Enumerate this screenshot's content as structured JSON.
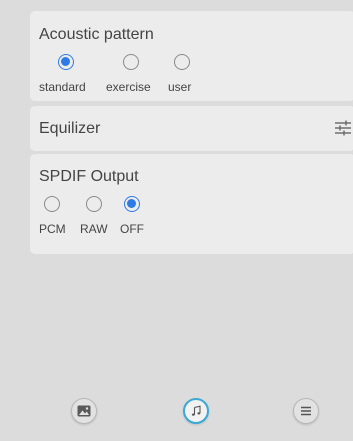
{
  "acoustic": {
    "title": "Acoustic pattern",
    "options": [
      {
        "label": "standard",
        "checked": true
      },
      {
        "label": "exercise",
        "checked": false
      },
      {
        "label": "user",
        "checked": false
      }
    ]
  },
  "equalizer": {
    "label": "Equilizer",
    "icon": "sliders-icon"
  },
  "spdif": {
    "title": "SPDIF Output",
    "options": [
      {
        "label": "PCM",
        "checked": false
      },
      {
        "label": "RAW",
        "checked": false
      },
      {
        "label": "OFF",
        "checked": true
      }
    ]
  },
  "bottom_nav": [
    {
      "icon": "image-icon",
      "active": false
    },
    {
      "icon": "music-note-icon",
      "active": true
    },
    {
      "icon": "menu-icon",
      "active": false
    }
  ],
  "colors": {
    "accent": "#2f7be6",
    "active_ring": "#3aa9d6",
    "background": "#dcdcdc",
    "card": "#ececec"
  }
}
